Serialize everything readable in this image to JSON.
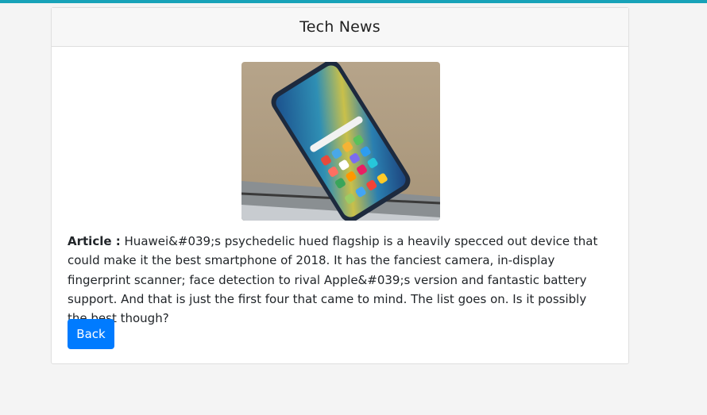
{
  "card": {
    "title": "Tech News"
  },
  "article": {
    "label": "Article :",
    "body": "Huawei&#039;s psychedelic hued flagship is a heavily specced out device that could make it the best smartphone of 2018. It has the fanciest camera, in-display fingerprint scanner; face detection to rival Apple&#039;s version and fantastic battery support. And that is just the first four that came to mind. The list goes on. Is it possibly the best though?"
  },
  "image": {
    "description": "smartphone photo"
  },
  "actions": {
    "back_label": "Back"
  },
  "colors": {
    "accent_bar": "#17a2b8",
    "button": "#007bff"
  }
}
